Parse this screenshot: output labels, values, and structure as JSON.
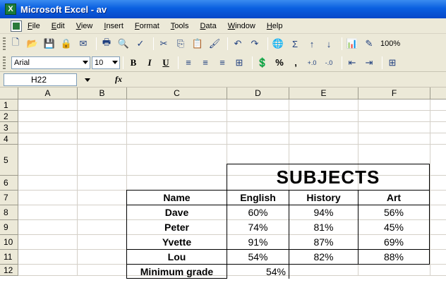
{
  "window": {
    "title": "Microsoft Excel - av",
    "app_icon": "excel-icon"
  },
  "menu": [
    "File",
    "Edit",
    "View",
    "Insert",
    "Format",
    "Tools",
    "Data",
    "Window",
    "Help"
  ],
  "toolbar_standard": {
    "zoom": "100%"
  },
  "toolbar_format": {
    "font": "Arial",
    "size": "10",
    "bold": "B",
    "italic": "I",
    "underline": "U",
    "percent": "%",
    "comma": ",",
    "fx": "fx"
  },
  "name_box": "H22",
  "columns": [
    "A",
    "B",
    "C",
    "D",
    "E",
    "F"
  ],
  "rows": [
    "1",
    "2",
    "3",
    "4",
    "5",
    "6",
    "7",
    "8",
    "9",
    "10",
    "11",
    "12"
  ],
  "sheet": {
    "title": "SUBJECTS",
    "headers": [
      "Name",
      "English",
      "History",
      "Art"
    ],
    "students": [
      {
        "name": "Dave",
        "english": "60%",
        "history": "94%",
        "art": "56%"
      },
      {
        "name": "Peter",
        "english": "74%",
        "history": "81%",
        "art": "45%"
      },
      {
        "name": "Yvette",
        "english": "91%",
        "history": "87%",
        "art": "69%"
      },
      {
        "name": "Lou",
        "english": "54%",
        "history": "82%",
        "art": "88%"
      }
    ],
    "min_label": "Minimum grade",
    "min_value": "54%"
  }
}
